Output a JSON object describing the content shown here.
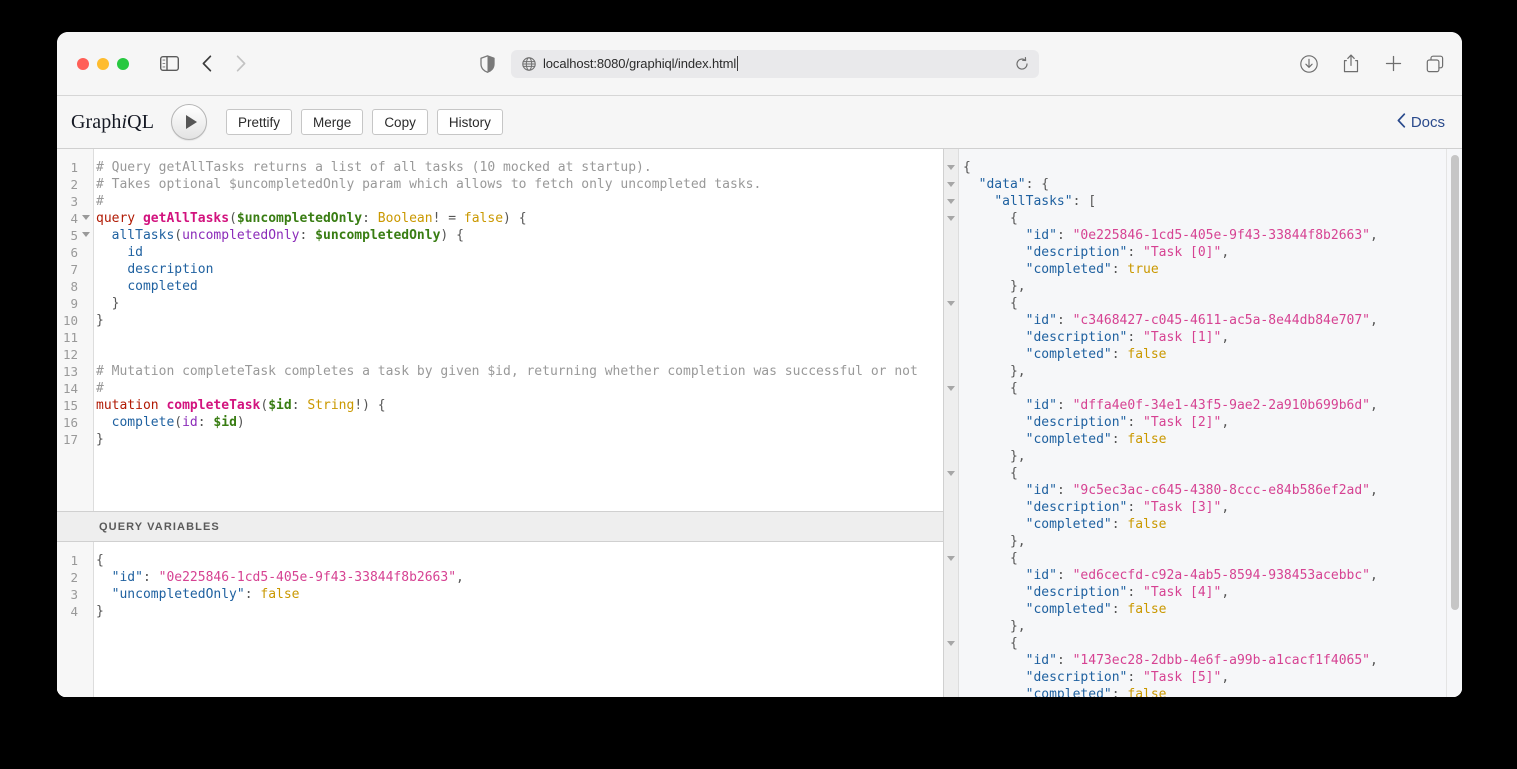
{
  "browser": {
    "url": "localhost:8080/graphiql/index.html",
    "icons": {
      "sidebar": "sidebar-toggle-icon",
      "back": "back-arrow-icon",
      "forward": "forward-arrow-icon",
      "shield": "privacy-shield-icon",
      "globe": "globe-icon",
      "reload": "reload-icon",
      "download": "download-icon",
      "share": "share-icon",
      "newtab": "new-tab-icon",
      "tabs": "tab-overview-icon"
    },
    "traffic_lights": {
      "close": "close-window-button",
      "minimize": "minimize-window-button",
      "maximize": "maximize-window-button"
    }
  },
  "toolbar": {
    "logo_prefix": "Graph",
    "logo_italic": "i",
    "logo_suffix": "QL",
    "execute_label": "execute-query-button",
    "prettify_label": "Prettify",
    "merge_label": "Merge",
    "copy_label": "Copy",
    "history_label": "History",
    "docs_label": "Docs",
    "docs_chevron": "‹"
  },
  "query_editor": {
    "line_numbers": [
      "1",
      "2",
      "3",
      "4",
      "5",
      "6",
      "7",
      "8",
      "9",
      "10",
      "11",
      "12",
      "13",
      "14",
      "15",
      "16",
      "17"
    ],
    "folded_lines": [
      4,
      5
    ],
    "lines": [
      "# Query getAllTasks returns a list of all tasks (10 mocked at startup).",
      "# Takes optional $uncompletedOnly param which allows to fetch only uncompleted tasks.",
      "#",
      "query getAllTasks($uncompletedOnly: Boolean! = false) {",
      "  allTasks(uncompletedOnly: $uncompletedOnly) {",
      "    id",
      "    description",
      "    completed",
      "  }",
      "}",
      "",
      "",
      "# Mutation completeTask completes a task by given $id, returning whether completion was successful or not",
      "#",
      "mutation completeTask($id: String!) {",
      "  complete(id: $id)",
      "}"
    ]
  },
  "query_variables": {
    "header": "QUERY VARIABLES",
    "line_numbers": [
      "1",
      "2",
      "3",
      "4"
    ],
    "lines": [
      "{",
      "  \"id\": \"0e225846-1cd5-405e-9f43-33844f8b2663\",",
      "  \"uncompletedOnly\": false",
      "}"
    ],
    "values": {
      "id": "0e225846-1cd5-405e-9f43-33844f8b2663",
      "uncompletedOnly": "false"
    }
  },
  "result": {
    "root_key": "data",
    "list_key": "allTasks",
    "tasks": [
      {
        "id": "0e225846-1cd5-405e-9f43-33844f8b2663",
        "description": "Task [0]",
        "completed": "true"
      },
      {
        "id": "c3468427-c045-4611-ac5a-8e44db84e707",
        "description": "Task [1]",
        "completed": "false"
      },
      {
        "id": "dffa4e0f-34e1-43f5-9ae2-2a910b699b6d",
        "description": "Task [2]",
        "completed": "false"
      },
      {
        "id": "9c5ec3ac-c645-4380-8ccc-e84b586ef2ad",
        "description": "Task [3]",
        "completed": "false"
      },
      {
        "id": "ed6cecfd-c92a-4ab5-8594-938453acebbc",
        "description": "Task [4]",
        "completed": "false"
      },
      {
        "id": "1473ec28-2dbb-4e6f-a99b-a1cacf1f4065",
        "description": "Task [5]",
        "completed": "false"
      }
    ]
  },
  "colors": {
    "keyword": "#b11a04",
    "def": "#d2137e",
    "variable": "#397d13",
    "atom": "#ca9800",
    "attribute": "#8b2bb9",
    "property": "#1f61a0",
    "string": "#d64292",
    "comment": "#999999",
    "docs_link": "#2a4a8c"
  }
}
